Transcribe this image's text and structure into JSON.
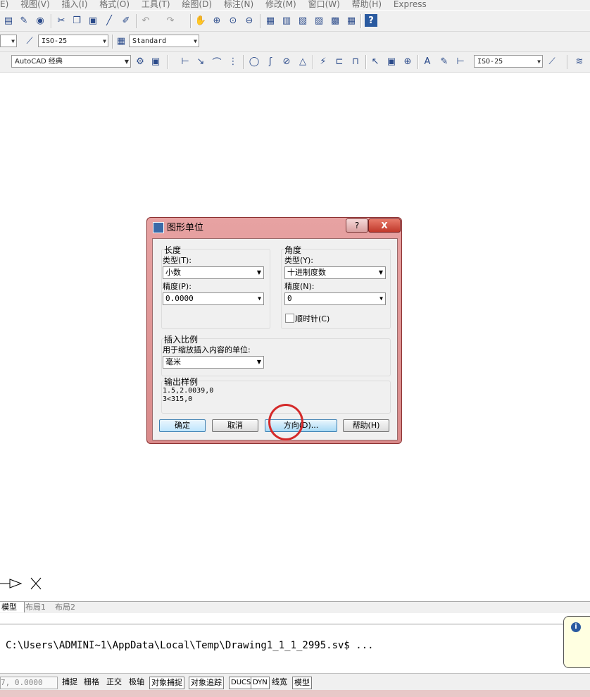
{
  "menubar": {
    "items": [
      "E)",
      "视图(V)",
      "插入(I)",
      "格式(O)",
      "工具(T)",
      "绘图(D)",
      "标注(N)",
      "修改(M)",
      "窗口(W)",
      "帮助(H)",
      "Express"
    ]
  },
  "toolbar": {
    "dimstyle": "ISO-25",
    "textstyle": "Standard",
    "workspace": "AutoCAD 经典",
    "dimstyle2": "ISO-25"
  },
  "dialog": {
    "title": "图形单位",
    "help_glyph": "?",
    "close_glyph": "X",
    "length": {
      "heading": "长度",
      "type_label": "类型(T):",
      "type_value": "小数",
      "precision_label": "精度(P):",
      "precision_value": "0.0000"
    },
    "angle": {
      "heading": "角度",
      "type_label": "类型(Y):",
      "type_value": "十进制度数",
      "precision_label": "精度(N):",
      "precision_value": "0",
      "clockwise_label": "顺时针(C)"
    },
    "insert": {
      "heading": "插入比例",
      "units_label": "用于缩放插入内容的单位:",
      "units_value": "毫米"
    },
    "output": {
      "heading": "输出样例",
      "line1": "1.5,2.0039,0",
      "line2": "3<315,0"
    },
    "buttons": {
      "ok": "确定",
      "cancel": "取消",
      "direction": "方向(D)...",
      "help": "帮助(H)"
    }
  },
  "tabs": [
    "模型",
    "布局1",
    "布局2"
  ],
  "command": {
    "text": "C:\\Users\\ADMINI~1\\AppData\\Local\\Temp\\Drawing1_1_1_2995.sv$ ..."
  },
  "statusbar": {
    "coord": "7, 0.0000",
    "items": [
      "捕捉",
      "栅格",
      "正交",
      "极轴",
      "对象捕捉",
      "对象追踪",
      "DUCS",
      "DYN",
      "线宽",
      "模型"
    ]
  }
}
